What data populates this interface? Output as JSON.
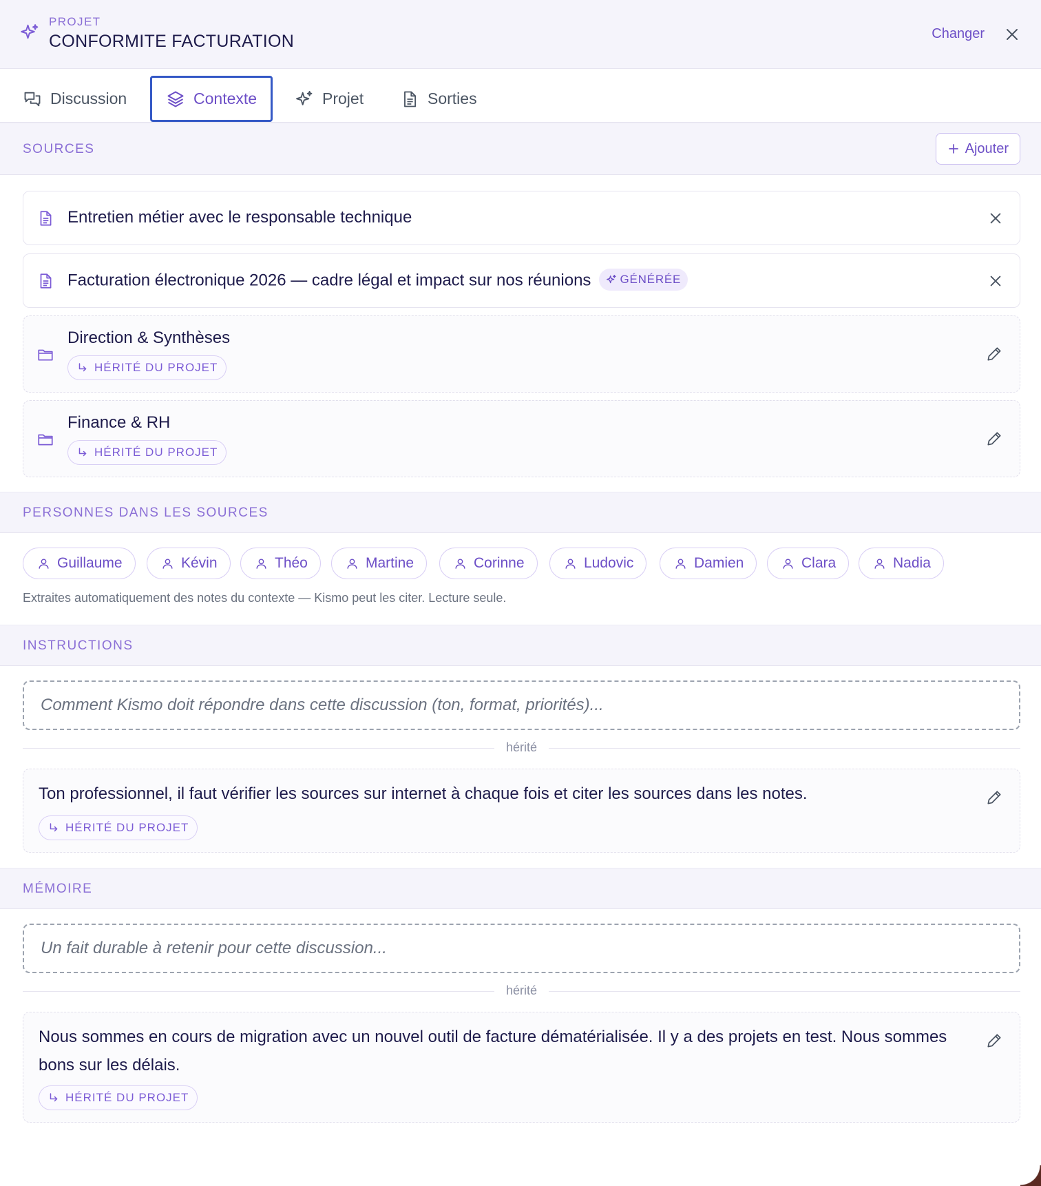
{
  "header": {
    "eyebrow": "PROJET",
    "title": "CONFORMITE FACTURATION",
    "change_label": "Changer"
  },
  "tabs": [
    {
      "label": "Discussion",
      "icon": "chat-icon"
    },
    {
      "label": "Contexte",
      "icon": "layers-icon",
      "active": true
    },
    {
      "label": "Projet",
      "icon": "sparkles-icon"
    },
    {
      "label": "Sorties",
      "icon": "document-icon"
    }
  ],
  "sources": {
    "heading": "SOURCES",
    "add_label": "Ajouter",
    "items": [
      {
        "title": "Entretien métier avec le responsable technique",
        "icon": "document-icon"
      },
      {
        "title": "Facturation électronique 2026 — cadre légal et impact sur nos réunions",
        "icon": "document-icon",
        "badge": "GÉNÉRÉE"
      },
      {
        "title": "Direction & Synthèses",
        "icon": "folder-icon",
        "tag": "HÉRITÉ DU PROJET"
      },
      {
        "title": "Finance & RH",
        "icon": "folder-icon",
        "tag": "HÉRITÉ DU PROJET"
      }
    ]
  },
  "people": {
    "heading": "PERSONNES DANS LES SOURCES",
    "names": [
      "Guillaume",
      "Kévin",
      "Théo",
      "Martine",
      "Corinne",
      "Ludovic",
      "Damien",
      "Clara",
      "Nadia"
    ],
    "hint": "Extraites automatiquement des notes du contexte — Kismo peut les citer. Lecture seule."
  },
  "instructions": {
    "heading": "INSTRUCTIONS",
    "placeholder": "Comment Kismo doit répondre dans cette discussion (ton, format, priorités)...",
    "divider": "hérité",
    "inherited_text": "Ton professionnel, il faut vérifier les sources sur internet à chaque fois et citer les sources dans les notes.",
    "tag": "HÉRITÉ DU PROJET"
  },
  "memory": {
    "heading": "MÉMOIRE",
    "placeholder": "Un fait durable à retenir pour cette discussion...",
    "divider": "hérité",
    "inherited_text": "Nous sommes en cours de migration avec un nouvel outil de facture dématérialisée. Il y a des projets en test. Nous sommes bons sur les délais.",
    "tag": "HÉRITÉ DU PROJET"
  },
  "colors": {
    "accent": "#6d4fc7",
    "accent_light": "#8b6fd6",
    "active_tab_border": "#3559c6",
    "section_bg": "#f5f4fb",
    "text": "#1e1b4b"
  }
}
